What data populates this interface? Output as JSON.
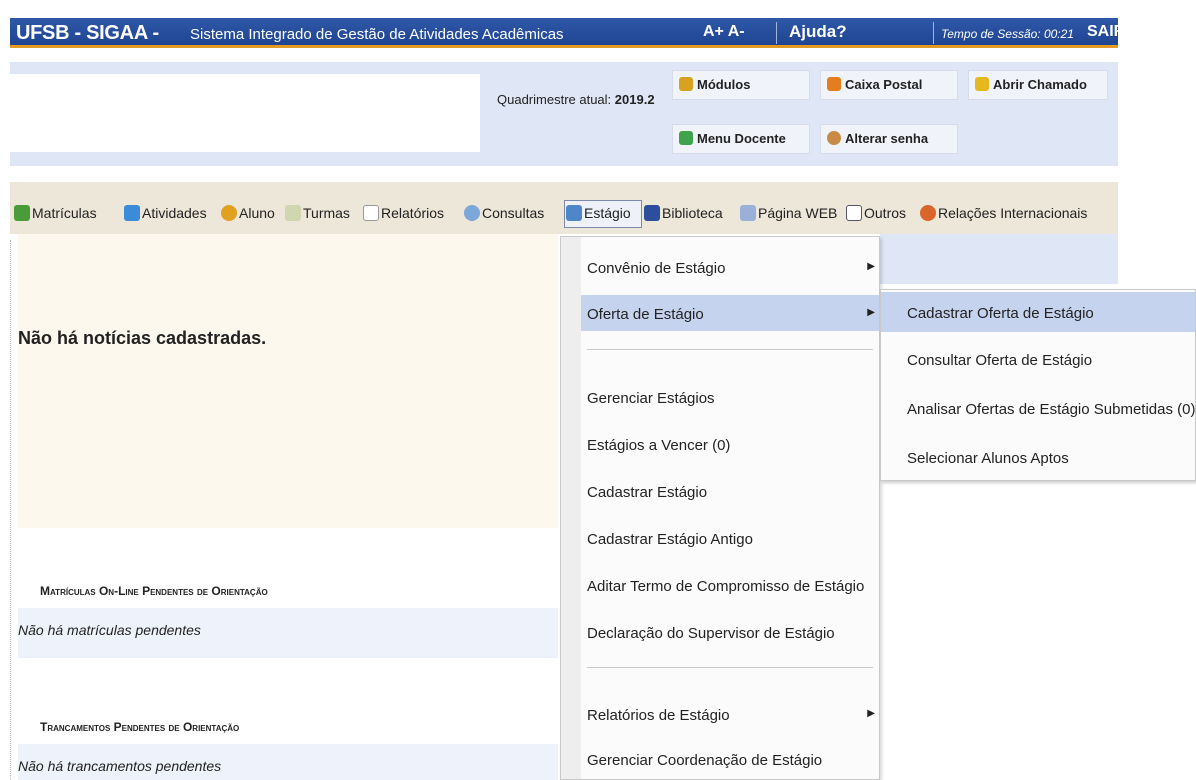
{
  "topbar": {
    "app_name": "UFSB - SIGAA -",
    "subtitle": "Sistema Integrado de Gestão de Atividades Acadêmicas",
    "font_controls": "A+  A-",
    "help": "Ajuda?",
    "session_label": "Tempo de Sessão: 00:21",
    "exit": "SAIR"
  },
  "header": {
    "period_label": "Quadrimestre atual:",
    "period_value": "2019.2",
    "buttons": {
      "modulos": "Módulos",
      "caixa_postal": "Caixa Postal",
      "abrir_chamado": "Abrir Chamado",
      "menu_docente": "Menu Docente",
      "alterar_senha": "Alterar senha"
    }
  },
  "menubar": {
    "items": [
      "Matrículas",
      "Atividades",
      "Aluno",
      "Turmas",
      "Relatórios",
      "Consultas",
      "Estágio",
      "Biblioteca",
      "Página WEB",
      "Outros",
      "Relações Internacionais"
    ]
  },
  "main": {
    "news_message": "Não há notícias cadastradas.",
    "section1_title": "Matrículas On-Line Pendentes de Orientação",
    "section1_text": "Não há matrículas pendentes",
    "section2_title": "Trancamentos Pendentes de Orientação",
    "section2_text": "Não há trancamentos pendentes"
  },
  "dropdown": {
    "items": [
      "Convênio de Estágio",
      "Oferta de Estágio",
      "Gerenciar Estágios",
      "Estágios a Vencer (0)",
      "Cadastrar Estágio",
      "Cadastrar Estágio Antigo",
      "Aditar Termo de Compromisso de Estágio",
      "Declaração do Supervisor de Estágio",
      "Relatórios de Estágio",
      "Gerenciar Coordenação de Estágio"
    ]
  },
  "submenu": {
    "items": [
      "Cadastrar Oferta de Estágio",
      "Consultar Oferta de Estágio",
      "Analisar Ofertas de Estágio Submetidas (0)",
      "Selecionar Alunos Aptos"
    ]
  },
  "colors": {
    "topbar": "#2f58a8",
    "accent": "#e39a22",
    "header_bg": "#dfe6f5",
    "menubar_bg": "#ece7d8",
    "highlight": "#c6d3ee"
  }
}
